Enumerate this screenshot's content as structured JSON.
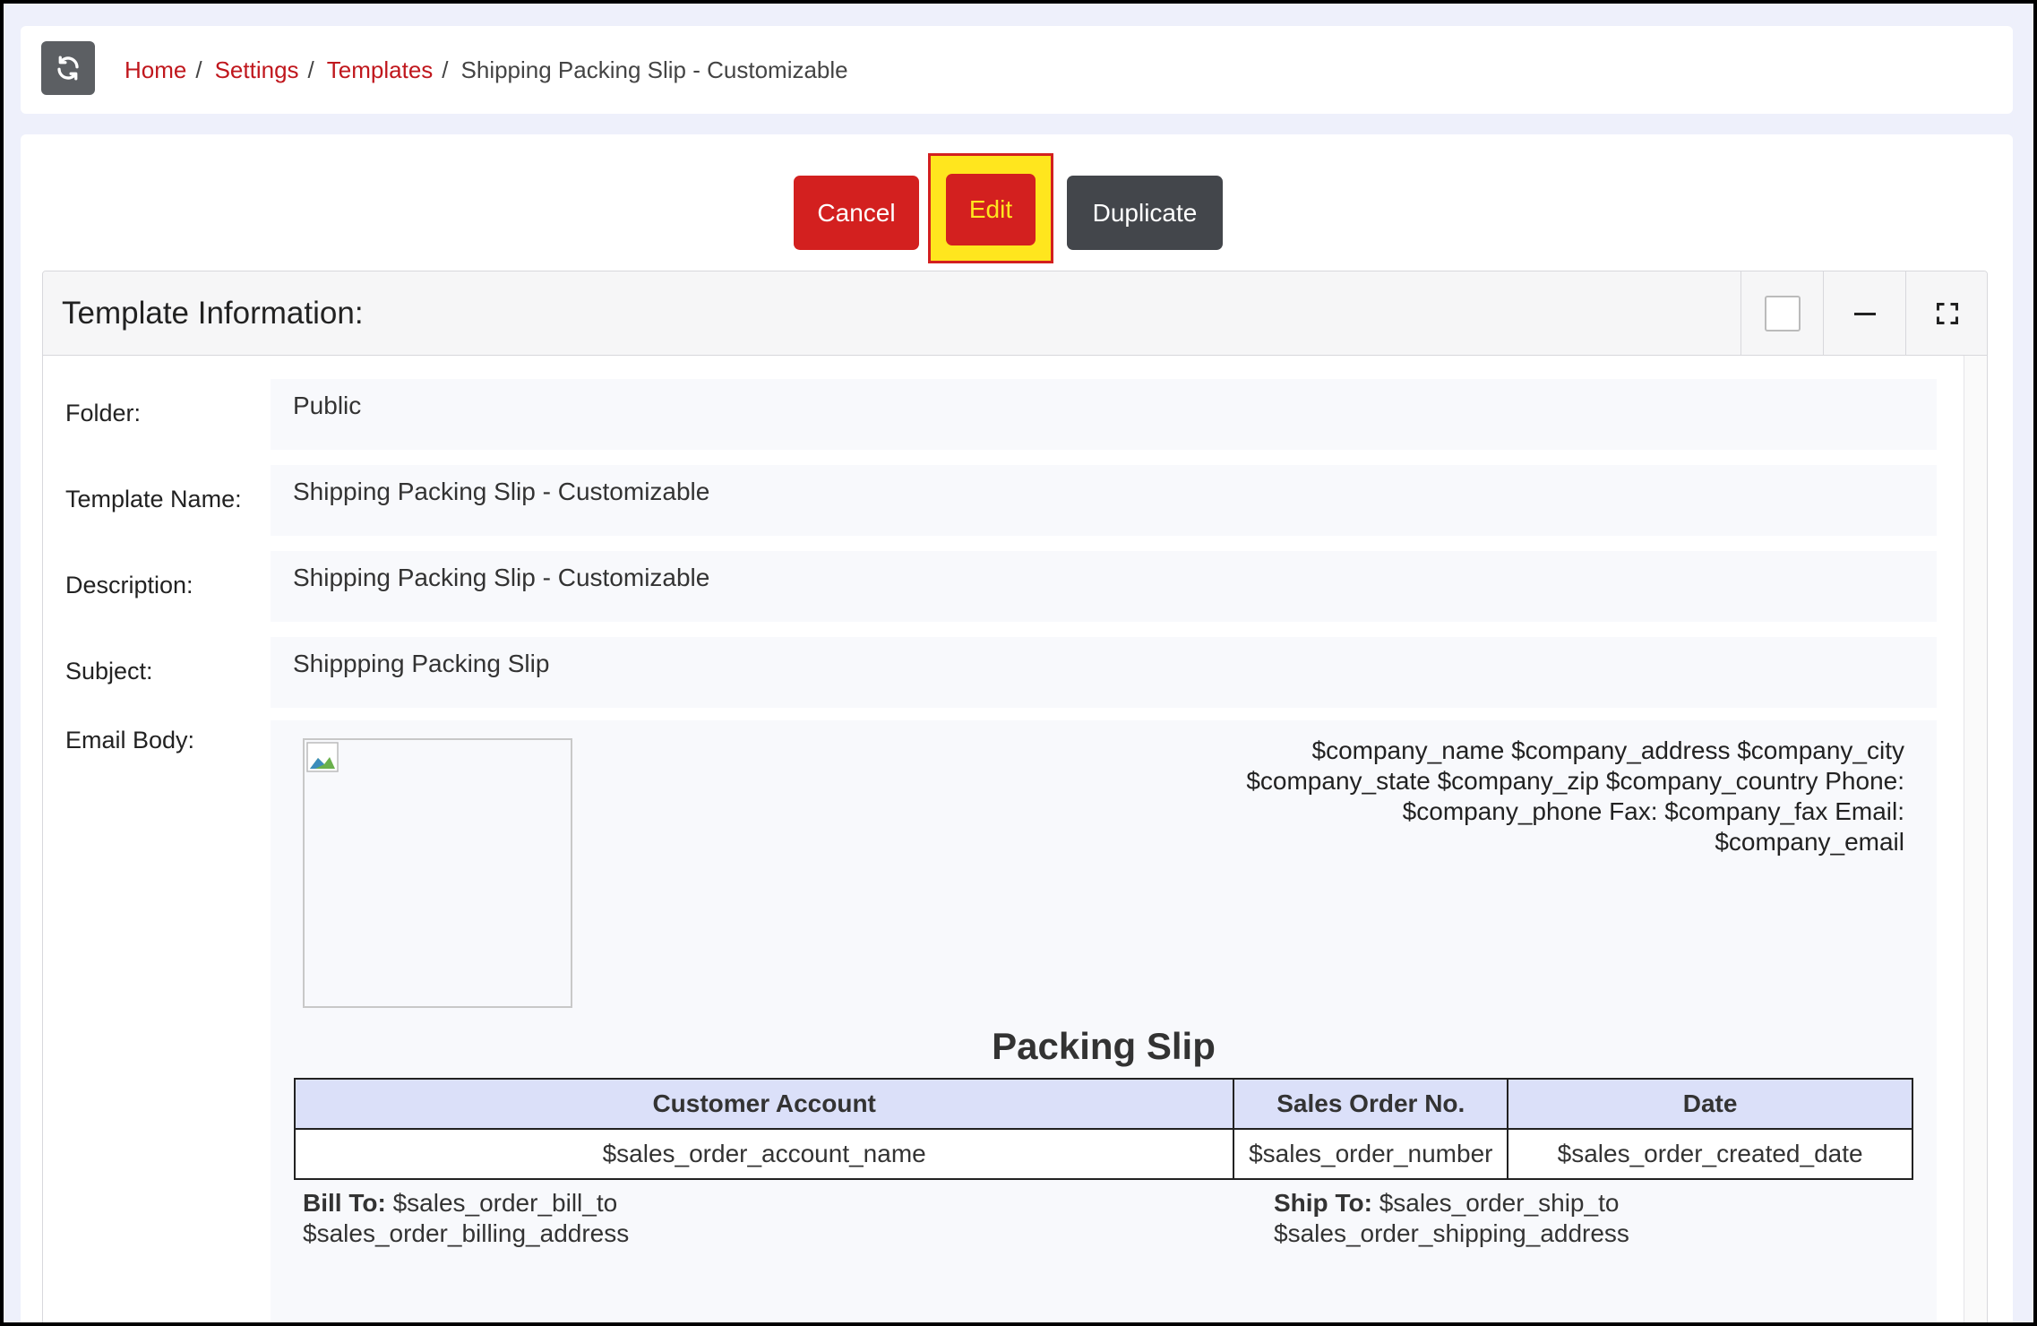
{
  "breadcrumb": {
    "home": "Home",
    "settings": "Settings",
    "templates": "Templates",
    "separator": "/",
    "current": "Shipping Packing Slip - Customizable"
  },
  "actions": {
    "cancel": "Cancel",
    "edit": "Edit",
    "duplicate": "Duplicate"
  },
  "panel": {
    "title": "Template Information:"
  },
  "fields": {
    "folder_label": "Folder:",
    "folder_value": "Public",
    "name_label": "Template Name:",
    "name_value": "Shipping Packing Slip - Customizable",
    "description_label": "Description:",
    "description_value": "Shipping Packing Slip - Customizable",
    "subject_label": "Subject:",
    "subject_value": "Shippping Packing Slip",
    "body_label": "Email Body:"
  },
  "email_body": {
    "company_line1": "$company_name $company_address $company_city",
    "company_line2": "$company_state $company_zip $company_country Phone:",
    "company_line3": "$company_phone Fax: $company_fax Email:",
    "company_line4": "$company_email",
    "heading": "Packing Slip",
    "table": {
      "headers": [
        "Customer Account",
        "Sales Order No.",
        "Date"
      ],
      "row": [
        "$sales_order_account_name",
        "$sales_order_number",
        "$sales_order_created_date"
      ]
    },
    "bill_to_label": "Bill To:",
    "bill_to_line1": "$sales_order_bill_to",
    "bill_to_line2": "$sales_order_billing_address",
    "ship_to_label": "Ship To:",
    "ship_to_line1": "$sales_order_ship_to",
    "ship_to_line2": "$sales_order_shipping_address"
  },
  "colors": {
    "link": "#c0171d",
    "danger": "#d3201f",
    "highlight": "#ffe61e",
    "dark_button": "#43464b",
    "table_header": "#dbe0f9",
    "background": "#eef0fb"
  },
  "icons": {
    "refresh": "refresh-icon",
    "checkbox": "checkbox-icon",
    "minimize": "minus-icon",
    "fullscreen": "expand-icon",
    "broken_image": "broken-image-icon"
  }
}
